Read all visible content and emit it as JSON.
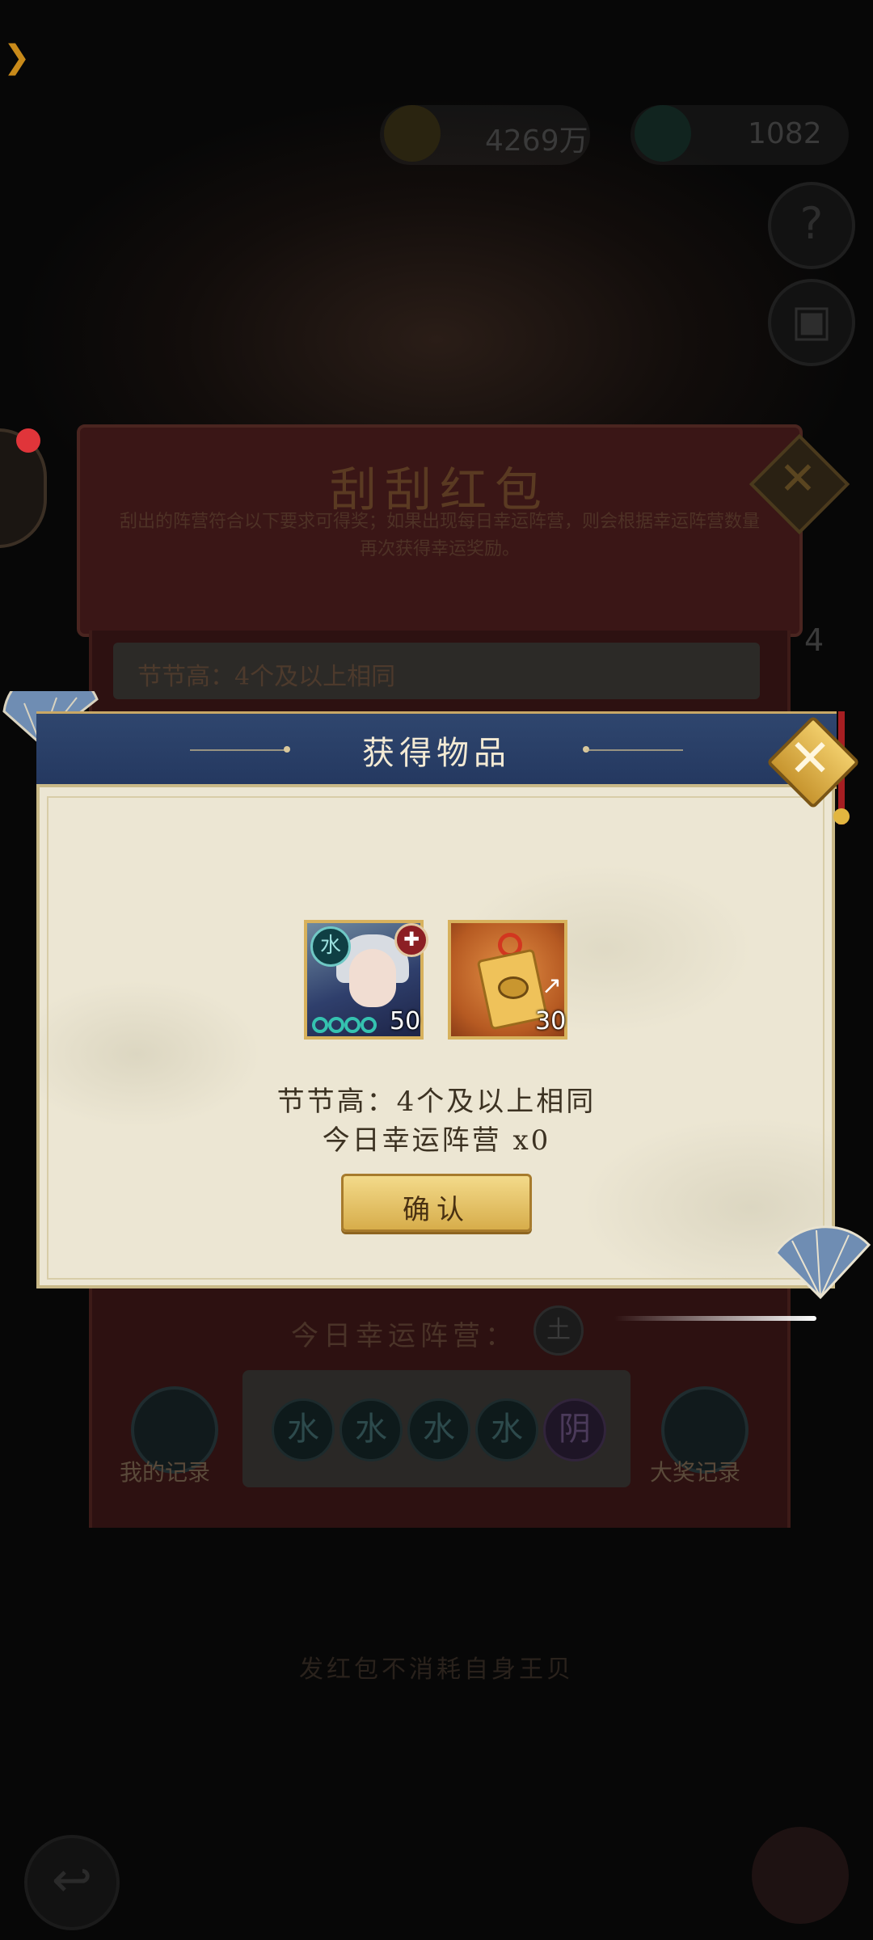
{
  "background": {
    "currency_amount": "4269万",
    "gem_amount": "1082",
    "help_icon_glyph": "?",
    "scratch_title": "刮刮红包",
    "scratch_description": "刮出的阵营符合以下要求可得奖；如果出现每日幸运阵营，则会根据幸运阵营数量再次获得幸运奖励。",
    "rule_text": "节节高：4个及以上相同",
    "side_counter": "4",
    "lucky_faction_label": "今日幸运阵营：",
    "lucky_faction_glyph": "土",
    "scratch_tokens": [
      "水",
      "水",
      "水",
      "水",
      "阴"
    ],
    "my_records_label": "我的记录",
    "grand_prize_records_label": "大奖记录",
    "footer_tip": "发红包不消耗自身王贝"
  },
  "modal": {
    "title": "获得物品",
    "close_glyph": "✕",
    "items": [
      {
        "name": "hero-shard",
        "count": "50",
        "faction_glyph": "水",
        "stars": 4
      },
      {
        "name": "talisman",
        "count": "30"
      }
    ],
    "result_line1": "节节高：4个及以上相同",
    "result_line2": "今日幸运阵营 x0",
    "confirm_label": "确认"
  },
  "colors": {
    "modal_header": "#2f466e",
    "modal_body": "#ece6d3",
    "gold": "#d7ad4b"
  }
}
